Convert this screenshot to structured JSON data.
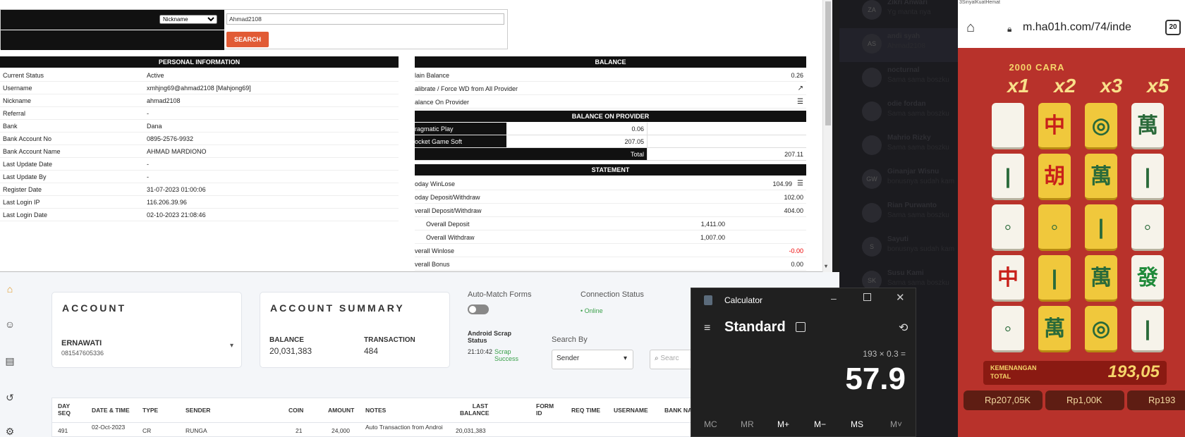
{
  "admin": {
    "search": {
      "field_option": "Nickname",
      "value": "Ahmad2108",
      "button": "SEARCH"
    },
    "personal": {
      "title": "PERSONAL INFORMATION",
      "rows": [
        {
          "k": "Current Status",
          "v": "Active"
        },
        {
          "k": "Username",
          "v": "xmhjng69@ahmad2108  [Mahjong69]"
        },
        {
          "k": "Nickname",
          "v": "ahmad2108"
        },
        {
          "k": "Referral",
          "v": "-"
        },
        {
          "k": "Bank",
          "v": "Dana"
        },
        {
          "k": "Bank Account No",
          "v": "0895-2576-9932"
        },
        {
          "k": "Bank Account Name",
          "v": "AHMAD MARDIONO"
        },
        {
          "k": "Last Update Date",
          "v": "-"
        },
        {
          "k": "Last Update By",
          "v": "-"
        },
        {
          "k": "Register Date",
          "v": "31-07-2023 01:00:06"
        },
        {
          "k": "Last Login IP",
          "v": "116.206.39.96"
        },
        {
          "k": "Last Login Date",
          "v": "02-10-2023 21:08:46"
        }
      ]
    },
    "balance": {
      "title": "BALANCE",
      "main_label": "lain Balance",
      "main_value": "0.26",
      "calibrate_label": "alibrate / Force WD from All Provider",
      "on_provider_label": "alance On Provider",
      "provider_title": "BALANCE ON PROVIDER",
      "providers": [
        {
          "k": "ragmatic Play",
          "v": "0.06"
        },
        {
          "k": "ocket Game Soft",
          "v": "207.05"
        }
      ],
      "total_label": "Total",
      "total_value": "207.11",
      "statement_title": "STATEMENT",
      "statement": [
        {
          "k": "oday WinLose",
          "v": "104.99"
        },
        {
          "k": "oday Deposit/Withdraw",
          "v": "102.00"
        },
        {
          "k": "verall Deposit/Withdraw",
          "v": "404.00"
        },
        {
          "k": "Overall Deposit",
          "v": "1,411.00"
        },
        {
          "k": "Overall Withdraw",
          "v": "1,007.00"
        },
        {
          "k": "verall Winlose",
          "v": "-0.00"
        },
        {
          "k": "verall Bonus",
          "v": "0.00"
        }
      ]
    }
  },
  "bgapp": {
    "account_title": "ACCOUNT",
    "account_name": "ERNAWATI",
    "account_phone": "081547605336",
    "summary_title": "ACCOUNT SUMMARY",
    "balance_label": "BALANCE",
    "balance_value": "20,031,383",
    "transaction_label": "TRANSACTION",
    "transaction_value": "484",
    "automatch_label": "Auto-Match Forms",
    "connection_label": "Connection Status",
    "connection_value": "• Online",
    "scrap_label": "Android Scrap Status",
    "scrap_time": "21:10:42",
    "scrap_value": "Scrap Success",
    "searchby_label": "Search By",
    "searchby_value": "Sender",
    "search_placeholder": "Searc",
    "table_headers": [
      "DAY SEQ",
      "DATE & TIME",
      "TYPE",
      "SENDER",
      "COIN",
      "AMOUNT",
      "NOTES",
      "LAST BALANCE",
      "FORM ID",
      "REQ TIME",
      "USERNAME",
      "BANK NA"
    ],
    "row": {
      "seq": "491",
      "date": "02-Oct-2023",
      "type": "CR",
      "sender": "RUNGA",
      "coin": "21",
      "amount": "24,000",
      "notes": "Auto Transaction from Androi",
      "last_balance": "20,031,383"
    }
  },
  "chat": {
    "rows": [
      {
        "av": "ZA",
        "name": "Zikri Anwari",
        "msg": "Yg manta nya"
      },
      {
        "av": "AS",
        "name": "andi syah",
        "msg": "Ahmad2108"
      },
      {
        "av": "",
        "name": "nocturnal",
        "msg": "Sama sama boszku"
      },
      {
        "av": "",
        "name": "odie fordan",
        "msg": "Sama sama boszku"
      },
      {
        "av": "",
        "name": "Mahrio Rizky",
        "msg": "Sama sama boszku"
      },
      {
        "av": "GW",
        "name": "Ginanjar Wisnu",
        "msg": "bonusnya sudah kam"
      },
      {
        "av": "",
        "name": "Rian Purwanto",
        "msg": "Sama sama boszku"
      },
      {
        "av": "S",
        "name": "Sayuti",
        "msg": "bonusnya sudah kam"
      },
      {
        "av": "SK",
        "name": "Susu Kami",
        "msg": "Sama sama boszku"
      }
    ]
  },
  "phone": {
    "carrier": "3SinyalKuatHemat",
    "url": "m.ha01h.com/74/inde",
    "tab_count": "20",
    "game": {
      "banner": "2000 CARA",
      "multipliers": [
        "x1",
        "x2",
        "x3",
        "x5"
      ],
      "win_label": "KEMENANGAN TOTAL",
      "win_value": "193,05",
      "balances": [
        "Rp207,05K",
        "Rp1,00K",
        "Rp193"
      ]
    }
  },
  "calculator": {
    "title": "Calculator",
    "mode": "Standard",
    "expression": "193 × 0.3 =",
    "result": "57.9",
    "memory": [
      "MC",
      "MR",
      "M+",
      "M−",
      "MS",
      "M˅"
    ]
  }
}
